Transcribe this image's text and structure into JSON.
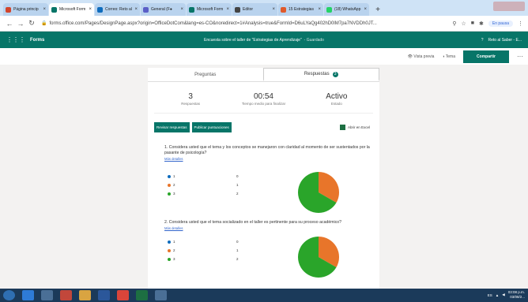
{
  "browser": {
    "tabs": [
      {
        "title": "Página princip",
        "color": "#d2452b",
        "active": false
      },
      {
        "title": "Microsoft Form",
        "color": "#077568",
        "active": true
      },
      {
        "title": "Correo: Reto al",
        "color": "#0f6cbd",
        "active": false
      },
      {
        "title": "General (F●",
        "color": "#5b5fc7",
        "active": false
      },
      {
        "title": "Microsoft Form",
        "color": "#077568",
        "active": false
      },
      {
        "title": "Editor",
        "color": "#444444",
        "active": false
      },
      {
        "title": "15 Estrategias",
        "color": "#e05a2b",
        "active": false
      },
      {
        "title": "(18) WhatsApp",
        "color": "#25d366",
        "active": false
      }
    ],
    "url": "forms.office.com/Pages/DesignPage.aspx?origin=OfficeDotCom&lang=es-CO&noredirect=1#Analysis=true&FormId=D6uLYaQg402hD0lM7pa7NVDDh0JT...",
    "profile_status": "En pausa"
  },
  "forms_header": {
    "app_name": "Forms",
    "form_title": "Encuesta sobre el taller de \"Estrategias de Aprendizaje\"",
    "saved": "- Guardado",
    "help": "?",
    "user": "Reto al Saber - E..."
  },
  "toolbar": {
    "preview": "Vista previa",
    "theme": "Tema",
    "share": "Compartir",
    "more": "···"
  },
  "tabs": {
    "questions": "Preguntas",
    "responses": "Respuestas",
    "responses_badge": "3"
  },
  "stats": {
    "responses_value": "3",
    "responses_label": "Respuestas",
    "time_value": "00:54",
    "time_label": "Tiempo medio para finalizar",
    "status_value": "Activo",
    "status_label": "Estado"
  },
  "actions": {
    "review": "Revisar respuestas",
    "publish": "Publicar puntuaciones",
    "excel": "Abrir en Excel"
  },
  "questions": [
    {
      "text": "1.  Considera usted que el tema y los conceptos se manejaron con claridad al momento de ser sustentados por la pasante de psicología?",
      "details": "Más detalles",
      "options": [
        {
          "label": "1",
          "count": "0",
          "color": "#0f6cbd"
        },
        {
          "label": "2",
          "count": "1",
          "color": "#e8752a"
        },
        {
          "label": "3",
          "count": "2",
          "color": "#2aa52a"
        }
      ]
    },
    {
      "text": "2.  Considera usted que el tema socializado en el taller es pertinente para su proceso académico?",
      "details": "Más detalles",
      "options": [
        {
          "label": "1",
          "count": "0",
          "color": "#0f6cbd"
        },
        {
          "label": "2",
          "count": "1",
          "color": "#e8752a"
        },
        {
          "label": "3",
          "count": "2",
          "color": "#2aa52a"
        }
      ]
    }
  ],
  "taskbar": {
    "language": "ES",
    "time": "03:08 p.m.",
    "date": "03/08/2..."
  }
}
